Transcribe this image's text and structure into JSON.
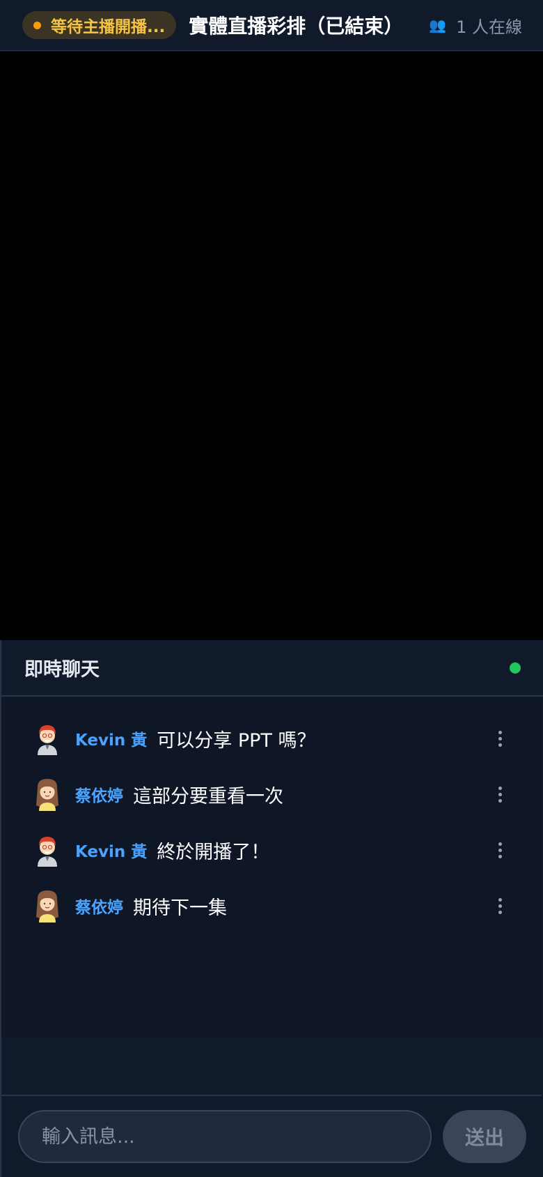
{
  "header": {
    "status_label": "等待主播開播...",
    "title": "實體直播彩排（已結束）",
    "viewers_icon": "users-icon",
    "viewers_text": "1 人在線"
  },
  "chat": {
    "title": "即時聊天",
    "online_color": "#22c55e",
    "messages": [
      {
        "name": "Kevin 黃",
        "text": "可以分享 PPT 嗎？",
        "avatar": "man-avatar"
      },
      {
        "name": "蔡依婷",
        "text": "這部分要重看一次",
        "avatar": "woman-avatar"
      },
      {
        "name": "Kevin 黃",
        "text": "終於開播了！",
        "avatar": "man-avatar"
      },
      {
        "name": "蔡依婷",
        "text": "期待下一集",
        "avatar": "woman-avatar"
      }
    ],
    "input_placeholder": "輸入訊息...",
    "send_label": "送出"
  },
  "colors": {
    "accent_name": "#4aa3ff",
    "status_text": "#f6c343",
    "status_dot": "#f59e0b"
  }
}
